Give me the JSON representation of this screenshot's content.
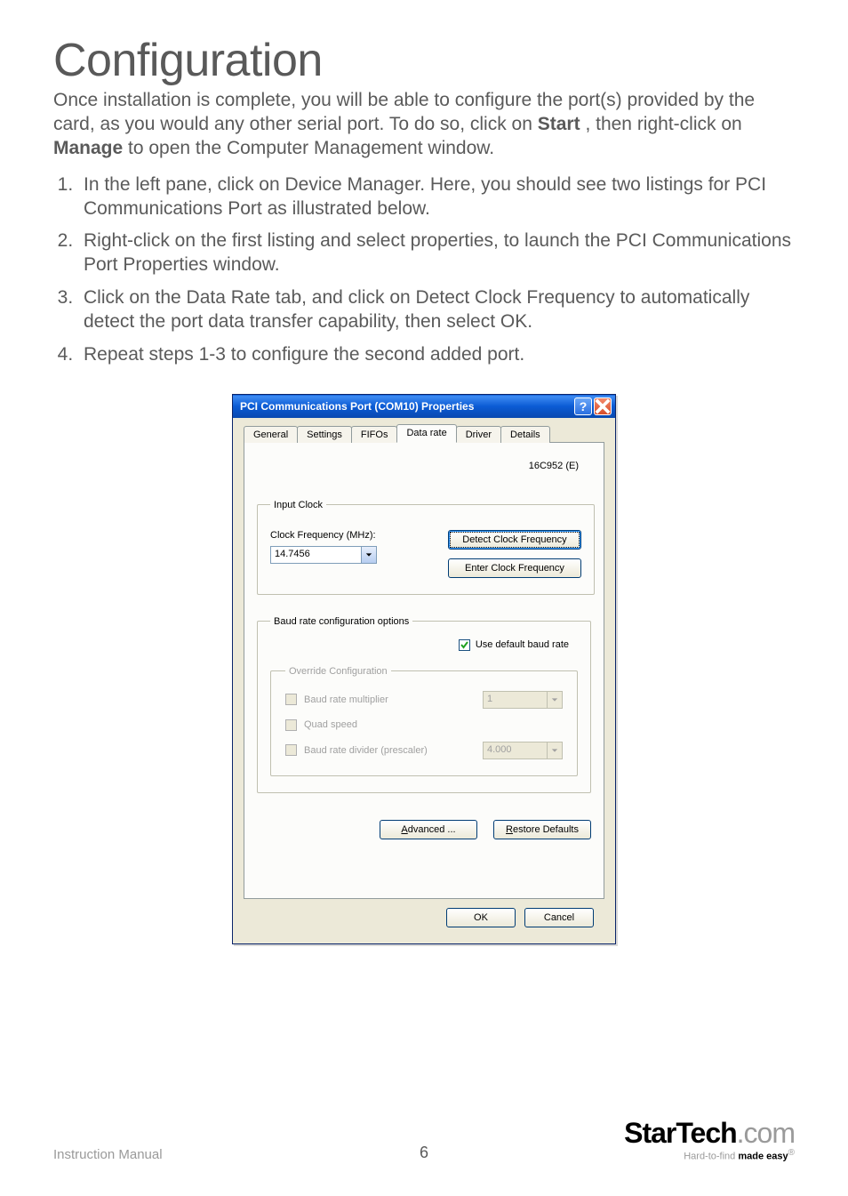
{
  "header": {
    "title": "Configuration"
  },
  "intro": {
    "text_a": "Once installation is complete, you will be able to configure the port(s) provided by the card, as you would any other serial port. To do so, click on ",
    "bold_start": "Start",
    "text_b": ", then right-click on ",
    "bold_manage": "Manage",
    "text_c": " to open the Computer Management window."
  },
  "steps": [
    "In the left pane, click on Device Manager. Here, you should see two listings for PCI Communications Port as illustrated below.",
    "Right-click on the first listing and select properties, to launch the PCI Communications Port Properties window.",
    "Click on the Data Rate tab, and click on Detect Clock Frequency to automatically detect the port data transfer capability, then select OK.",
    "Repeat steps 1-3 to configure the second added port."
  ],
  "dialog": {
    "title": "PCI Communications Port (COM10) Properties",
    "tabs": [
      "General",
      "Settings",
      "FIFOs",
      "Data rate",
      "Driver",
      "Details"
    ],
    "active_tab": "Data rate",
    "chip": "16C952 (E)",
    "input_clock": {
      "legend": "Input Clock",
      "label": "Clock Frequency (MHz):",
      "value": "14.7456",
      "btn_detect": "Detect Clock Frequency",
      "btn_enter": "Enter Clock Frequency"
    },
    "baud": {
      "legend": "Baud rate configuration options",
      "use_default": "Use default baud rate",
      "override_legend": "Override Configuration",
      "options": {
        "multiplier_label": "Baud rate multiplier",
        "multiplier_value": "1",
        "quad_label": "Quad speed",
        "divider_label": "Baud rate divider (prescaler)",
        "divider_value": "4.000"
      }
    },
    "buttons": {
      "advanced_pre": "A",
      "advanced_post": "dvanced ...",
      "restore_pre": "R",
      "restore_post": "estore Defaults",
      "ok": "OK",
      "cancel": "Cancel"
    }
  },
  "footer": {
    "left": "Instruction Manual",
    "page": "6",
    "logo_bold": "StarTech",
    "logo_light": ".com",
    "tag_pre": "Hard-to-find ",
    "tag_bold": "made easy"
  }
}
